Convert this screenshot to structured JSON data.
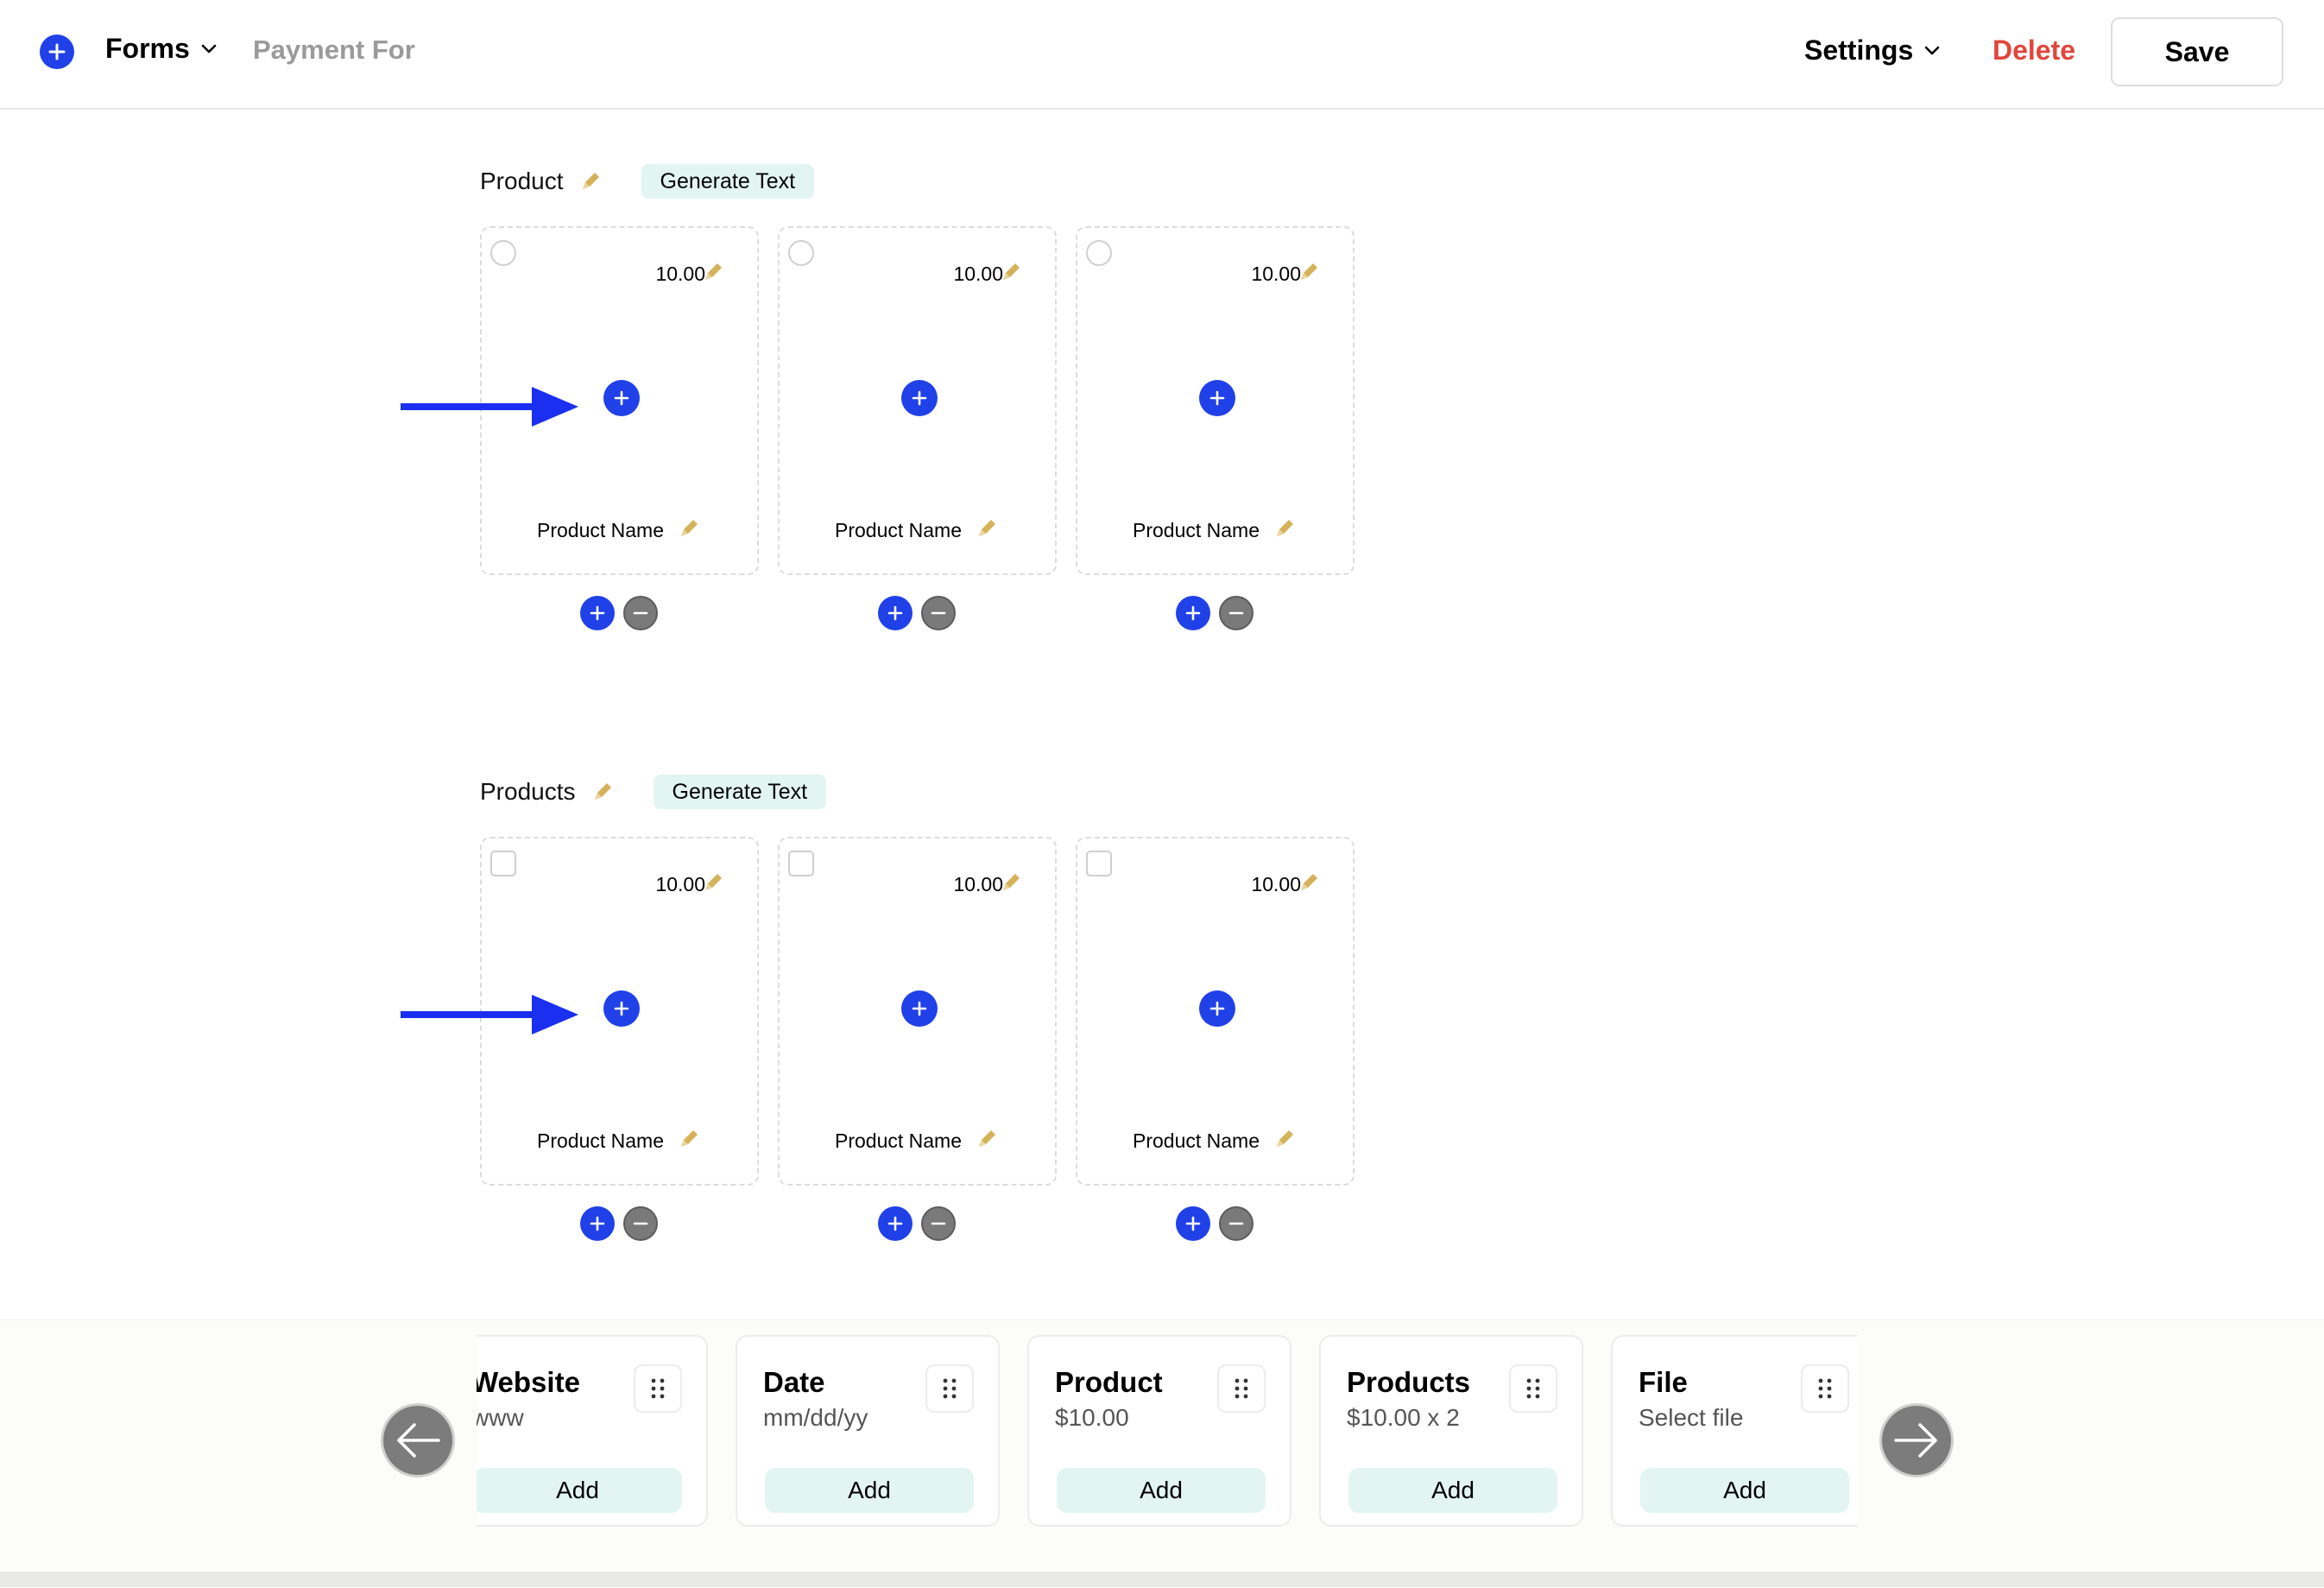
{
  "header": {
    "forms_label": "Forms",
    "breadcrumb": "Payment For",
    "settings_label": "Settings",
    "delete_label": "Delete",
    "save_label": "Save"
  },
  "sections": [
    {
      "title": "Product",
      "generate_label": "Generate Text",
      "selector": "radio",
      "cards": [
        {
          "price": "10.00",
          "name": "Product Name"
        },
        {
          "price": "10.00",
          "name": "Product Name"
        },
        {
          "price": "10.00",
          "name": "Product Name"
        }
      ]
    },
    {
      "title": "Products",
      "generate_label": "Generate Text",
      "selector": "checkbox",
      "cards": [
        {
          "price": "10.00",
          "name": "Product Name"
        },
        {
          "price": "10.00",
          "name": "Product Name"
        },
        {
          "price": "10.00",
          "name": "Product Name"
        }
      ]
    }
  ],
  "field_types": [
    {
      "title": "Website",
      "subtitle": "www",
      "add_label": "Add"
    },
    {
      "title": "Date",
      "subtitle": "mm/dd/yy",
      "add_label": "Add"
    },
    {
      "title": "Product",
      "subtitle": "$10.00",
      "add_label": "Add"
    },
    {
      "title": "Products",
      "subtitle": "$10.00 x 2",
      "add_label": "Add"
    },
    {
      "title": "File",
      "subtitle": "Select file",
      "add_label": "Add"
    }
  ],
  "colors": {
    "accent_blue": "#2040e8",
    "delete_red": "#e0463c",
    "pencil_gold": "#d4b25a",
    "mint": "#e3f5f3"
  }
}
